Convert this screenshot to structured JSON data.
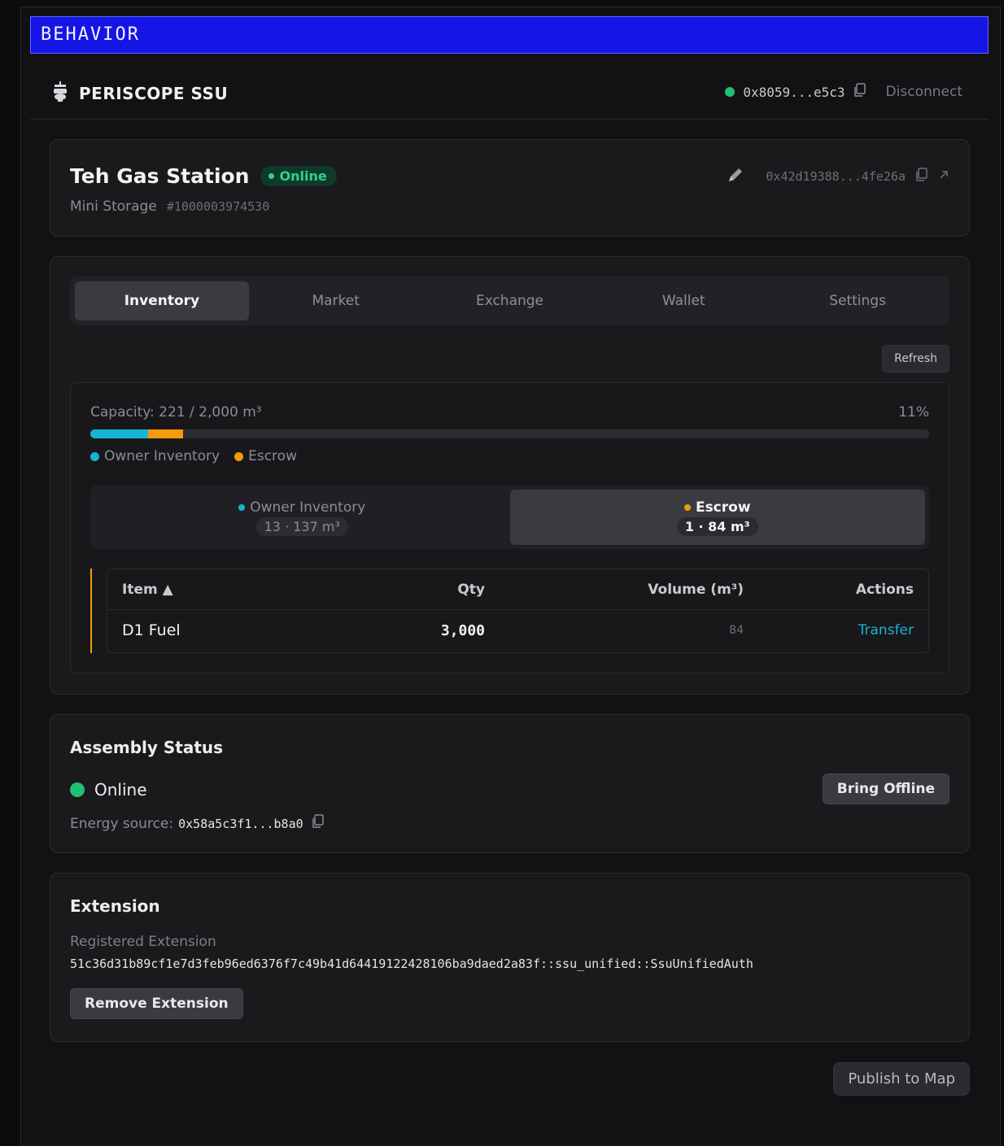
{
  "banner": {
    "label": "BEHAVIOR"
  },
  "header": {
    "brand_name": "PERISCOPE SSU",
    "wallet_address": "0x8059...e5c3",
    "disconnect_label": "Disconnect"
  },
  "ssu": {
    "name": "Teh Gas Station",
    "status_badge": "Online",
    "type": "Mini Storage",
    "item_id": "#1000003974530",
    "object_id": "0x42d19388...4fe26a"
  },
  "tabs": [
    {
      "label": "Inventory",
      "active": true
    },
    {
      "label": "Market"
    },
    {
      "label": "Exchange"
    },
    {
      "label": "Wallet"
    },
    {
      "label": "Settings"
    }
  ],
  "inventory": {
    "refresh_label": "Refresh",
    "capacity_label": "Capacity: 221 / 2,000 m³",
    "capacity_percent": "11%",
    "owner_fraction": 0.0685,
    "escrow_fraction": 0.042,
    "legend": {
      "owner": "Owner Inventory",
      "escrow": "Escrow"
    },
    "segments": {
      "owner": {
        "label": "Owner Inventory",
        "count": "13 · 137 m³"
      },
      "escrow": {
        "label": "Escrow",
        "count": "1 · 84 m³"
      }
    },
    "table": {
      "headers": {
        "item": "Item",
        "qty": "Qty",
        "volume": "Volume (m³)",
        "actions": "Actions"
      },
      "rows": [
        {
          "item": "D1 Fuel",
          "qty": "3,000",
          "volume": "84",
          "action": "Transfer"
        }
      ]
    }
  },
  "assembly": {
    "title": "Assembly Status",
    "status": "Online",
    "action_label": "Bring Offline",
    "energy_label": "Energy source:",
    "energy_value": "0x58a5c3f1...b8a0"
  },
  "extension": {
    "title": "Extension",
    "label": "Registered Extension",
    "value": "51c36d31b89cf1e7d3feb96ed6376f7c49b41d64419122428106ba9daed2a83f::ssu_unified::SsuUnifiedAuth",
    "remove_label": "Remove Extension"
  },
  "footer": {
    "publish_label": "Publish to Map"
  },
  "colors": {
    "owner": "#16b4d4",
    "escrow": "#f59a0b",
    "online": "#1fbf74",
    "banner": "#1515e6"
  }
}
